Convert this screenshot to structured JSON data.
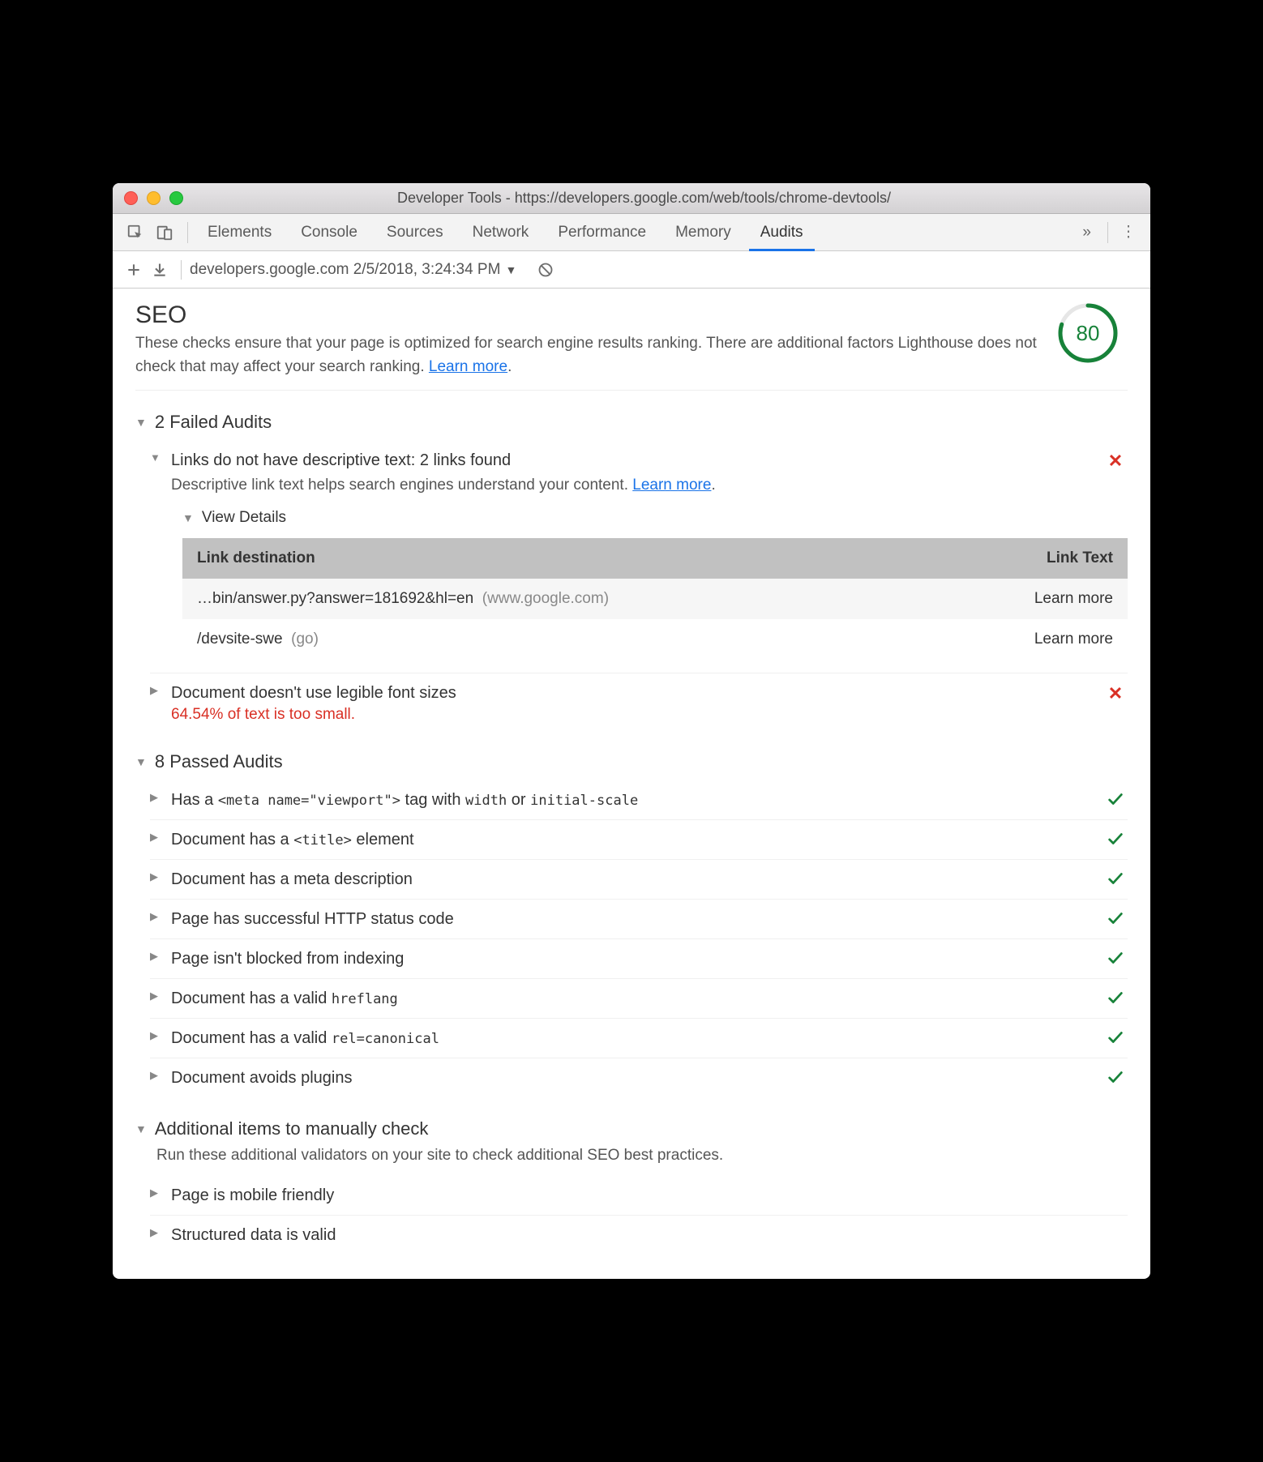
{
  "window_title": "Developer Tools - https://developers.google.com/web/tools/chrome-devtools/",
  "tabs": [
    "Elements",
    "Console",
    "Sources",
    "Network",
    "Performance",
    "Memory",
    "Audits"
  ],
  "active_tab": "Audits",
  "more_glyph": "»",
  "secondbar": {
    "label": "developers.google.com 2/5/2018, 3:24:34 PM"
  },
  "seo": {
    "title": "SEO",
    "desc_1": "These checks ensure that your page is optimized for search engine results ranking. There are additional factors Lighthouse does not check that may affect your search ranking. ",
    "learn_more": "Learn more",
    "score": "80"
  },
  "failed": {
    "header": "2 Failed Audits",
    "items": [
      {
        "title": "Links do not have descriptive text: 2 links found",
        "sub": "Descriptive link text helps search engines understand your content. ",
        "learn_more": "Learn more",
        "expanded": true,
        "view_details": "View Details",
        "table": {
          "col1": "Link destination",
          "col2": "Link Text",
          "rows": [
            {
              "dest": "…bin/answer.py?answer=181692&hl=en",
              "domain": "(www.google.com)",
              "text": "Learn more"
            },
            {
              "dest": "/devsite-swe",
              "domain": "(go)",
              "text": "Learn more"
            }
          ]
        }
      },
      {
        "title": "Document doesn't use legible font sizes",
        "warn": "64.54% of text is too small.",
        "expanded": false
      }
    ]
  },
  "passed": {
    "header": "8 Passed Audits",
    "items": [
      {
        "parts": [
          "Has a ",
          {
            "code": "<meta name=\"viewport\">"
          },
          " tag with ",
          {
            "code": "width"
          },
          " or ",
          {
            "code": "initial-scale"
          }
        ]
      },
      {
        "parts": [
          "Document has a ",
          {
            "code": "<title>"
          },
          " element"
        ]
      },
      {
        "parts": [
          "Document has a meta description"
        ]
      },
      {
        "parts": [
          "Page has successful HTTP status code"
        ]
      },
      {
        "parts": [
          "Page isn't blocked from indexing"
        ]
      },
      {
        "parts": [
          "Document has a valid ",
          {
            "code": "hreflang"
          }
        ]
      },
      {
        "parts": [
          "Document has a valid ",
          {
            "code": "rel=canonical"
          }
        ]
      },
      {
        "parts": [
          "Document avoids plugins"
        ]
      }
    ]
  },
  "manual": {
    "header": "Additional items to manually check",
    "desc": "Run these additional validators on your site to check additional SEO best practices.",
    "items": [
      "Page is mobile friendly",
      "Structured data is valid"
    ]
  }
}
